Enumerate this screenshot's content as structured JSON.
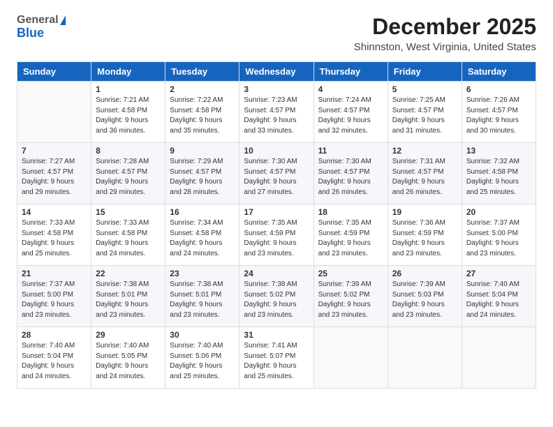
{
  "logo": {
    "general": "General",
    "blue": "Blue"
  },
  "title": "December 2025",
  "location": "Shinnston, West Virginia, United States",
  "days_header": [
    "Sunday",
    "Monday",
    "Tuesday",
    "Wednesday",
    "Thursday",
    "Friday",
    "Saturday"
  ],
  "weeks": [
    [
      {
        "day": "",
        "info": ""
      },
      {
        "day": "1",
        "info": "Sunrise: 7:21 AM\nSunset: 4:58 PM\nDaylight: 9 hours\nand 36 minutes."
      },
      {
        "day": "2",
        "info": "Sunrise: 7:22 AM\nSunset: 4:58 PM\nDaylight: 9 hours\nand 35 minutes."
      },
      {
        "day": "3",
        "info": "Sunrise: 7:23 AM\nSunset: 4:57 PM\nDaylight: 9 hours\nand 33 minutes."
      },
      {
        "day": "4",
        "info": "Sunrise: 7:24 AM\nSunset: 4:57 PM\nDaylight: 9 hours\nand 32 minutes."
      },
      {
        "day": "5",
        "info": "Sunrise: 7:25 AM\nSunset: 4:57 PM\nDaylight: 9 hours\nand 31 minutes."
      },
      {
        "day": "6",
        "info": "Sunrise: 7:26 AM\nSunset: 4:57 PM\nDaylight: 9 hours\nand 30 minutes."
      }
    ],
    [
      {
        "day": "7",
        "info": "Sunrise: 7:27 AM\nSunset: 4:57 PM\nDaylight: 9 hours\nand 29 minutes."
      },
      {
        "day": "8",
        "info": "Sunrise: 7:28 AM\nSunset: 4:57 PM\nDaylight: 9 hours\nand 29 minutes."
      },
      {
        "day": "9",
        "info": "Sunrise: 7:29 AM\nSunset: 4:57 PM\nDaylight: 9 hours\nand 28 minutes."
      },
      {
        "day": "10",
        "info": "Sunrise: 7:30 AM\nSunset: 4:57 PM\nDaylight: 9 hours\nand 27 minutes."
      },
      {
        "day": "11",
        "info": "Sunrise: 7:30 AM\nSunset: 4:57 PM\nDaylight: 9 hours\nand 26 minutes."
      },
      {
        "day": "12",
        "info": "Sunrise: 7:31 AM\nSunset: 4:57 PM\nDaylight: 9 hours\nand 26 minutes."
      },
      {
        "day": "13",
        "info": "Sunrise: 7:32 AM\nSunset: 4:58 PM\nDaylight: 9 hours\nand 25 minutes."
      }
    ],
    [
      {
        "day": "14",
        "info": "Sunrise: 7:33 AM\nSunset: 4:58 PM\nDaylight: 9 hours\nand 25 minutes."
      },
      {
        "day": "15",
        "info": "Sunrise: 7:33 AM\nSunset: 4:58 PM\nDaylight: 9 hours\nand 24 minutes."
      },
      {
        "day": "16",
        "info": "Sunrise: 7:34 AM\nSunset: 4:58 PM\nDaylight: 9 hours\nand 24 minutes."
      },
      {
        "day": "17",
        "info": "Sunrise: 7:35 AM\nSunset: 4:59 PM\nDaylight: 9 hours\nand 23 minutes."
      },
      {
        "day": "18",
        "info": "Sunrise: 7:35 AM\nSunset: 4:59 PM\nDaylight: 9 hours\nand 23 minutes."
      },
      {
        "day": "19",
        "info": "Sunrise: 7:36 AM\nSunset: 4:59 PM\nDaylight: 9 hours\nand 23 minutes."
      },
      {
        "day": "20",
        "info": "Sunrise: 7:37 AM\nSunset: 5:00 PM\nDaylight: 9 hours\nand 23 minutes."
      }
    ],
    [
      {
        "day": "21",
        "info": "Sunrise: 7:37 AM\nSunset: 5:00 PM\nDaylight: 9 hours\nand 23 minutes."
      },
      {
        "day": "22",
        "info": "Sunrise: 7:38 AM\nSunset: 5:01 PM\nDaylight: 9 hours\nand 23 minutes."
      },
      {
        "day": "23",
        "info": "Sunrise: 7:38 AM\nSunset: 5:01 PM\nDaylight: 9 hours\nand 23 minutes."
      },
      {
        "day": "24",
        "info": "Sunrise: 7:38 AM\nSunset: 5:02 PM\nDaylight: 9 hours\nand 23 minutes."
      },
      {
        "day": "25",
        "info": "Sunrise: 7:39 AM\nSunset: 5:02 PM\nDaylight: 9 hours\nand 23 minutes."
      },
      {
        "day": "26",
        "info": "Sunrise: 7:39 AM\nSunset: 5:03 PM\nDaylight: 9 hours\nand 23 minutes."
      },
      {
        "day": "27",
        "info": "Sunrise: 7:40 AM\nSunset: 5:04 PM\nDaylight: 9 hours\nand 24 minutes."
      }
    ],
    [
      {
        "day": "28",
        "info": "Sunrise: 7:40 AM\nSunset: 5:04 PM\nDaylight: 9 hours\nand 24 minutes."
      },
      {
        "day": "29",
        "info": "Sunrise: 7:40 AM\nSunset: 5:05 PM\nDaylight: 9 hours\nand 24 minutes."
      },
      {
        "day": "30",
        "info": "Sunrise: 7:40 AM\nSunset: 5:06 PM\nDaylight: 9 hours\nand 25 minutes."
      },
      {
        "day": "31",
        "info": "Sunrise: 7:41 AM\nSunset: 5:07 PM\nDaylight: 9 hours\nand 25 minutes."
      },
      {
        "day": "",
        "info": ""
      },
      {
        "day": "",
        "info": ""
      },
      {
        "day": "",
        "info": ""
      }
    ]
  ]
}
